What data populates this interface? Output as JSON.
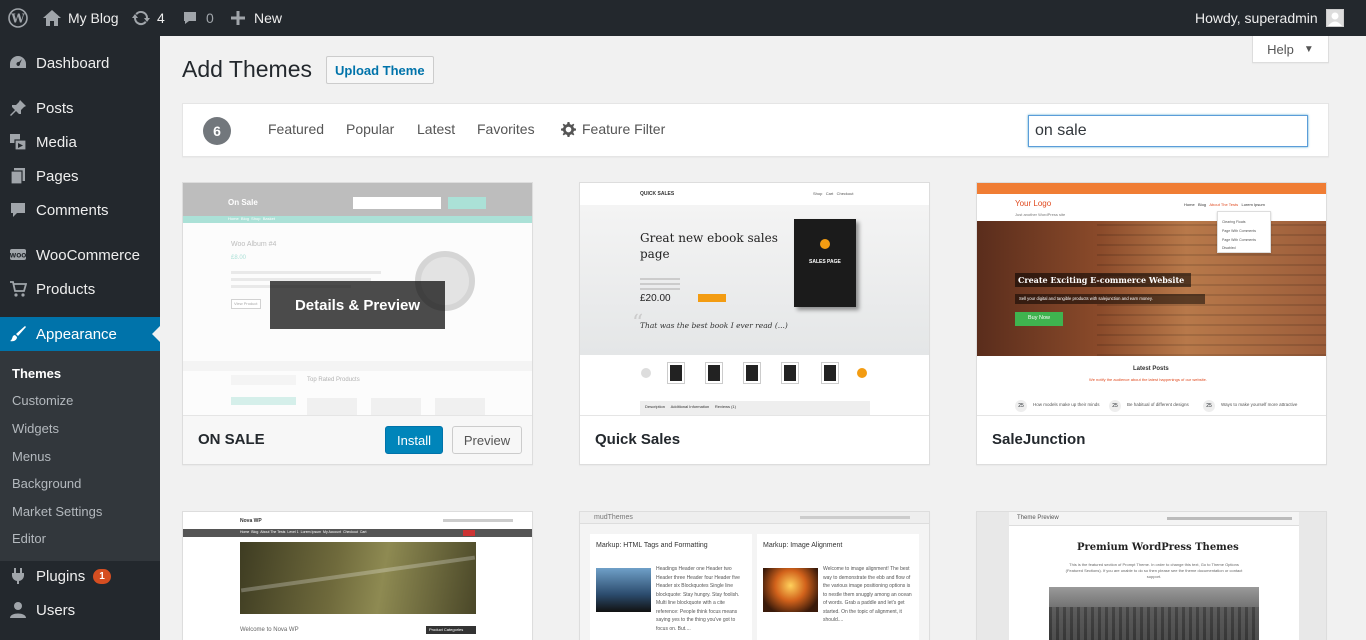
{
  "adminbar": {
    "site_name": "My Blog",
    "updates_count": "4",
    "comments_count": "0",
    "new_label": "New",
    "howdy": "Howdy, superadmin"
  },
  "sidebar": {
    "items": [
      {
        "label": "Dashboard",
        "icon": "dashboard-icon"
      },
      {
        "label": "Posts",
        "icon": "pin-icon"
      },
      {
        "label": "Media",
        "icon": "media-icon"
      },
      {
        "label": "Pages",
        "icon": "pages-icon"
      },
      {
        "label": "Comments",
        "icon": "comment-icon"
      },
      {
        "label": "WooCommerce",
        "icon": "woo-icon"
      },
      {
        "label": "Products",
        "icon": "cart-icon"
      },
      {
        "label": "Appearance",
        "icon": "brush-icon"
      },
      {
        "label": "Plugins",
        "icon": "plug-icon",
        "badge": "1"
      },
      {
        "label": "Users",
        "icon": "user-icon"
      }
    ],
    "submenu": [
      "Themes",
      "Customize",
      "Widgets",
      "Menus",
      "Background",
      "Market Settings",
      "Editor"
    ]
  },
  "page": {
    "title": "Add Themes",
    "upload_label": "Upload Theme",
    "help_label": "Help"
  },
  "filter": {
    "count": "6",
    "tabs": [
      "Featured",
      "Popular",
      "Latest",
      "Favorites"
    ],
    "feature_filter": "Feature Filter",
    "search_value": "on sale"
  },
  "themes": [
    {
      "name": "ON SALE",
      "install": "Install",
      "preview": "Preview",
      "overlay": "Details & Preview",
      "shot": {
        "logo": "On Sale",
        "album": "Woo Album #4",
        "view": "View Product",
        "top_rated": "Top Rated Products",
        "nav": [
          "Home",
          "Blog",
          "Shop",
          "Basket"
        ],
        "price": "£8.00"
      }
    },
    {
      "name": "Quick Sales",
      "shot": {
        "logo": "QUICK SALES",
        "headline1": "Great new ebook sales",
        "headline2": "page",
        "price": "£20.00",
        "quote": "That was the best book I ever read (...)",
        "book": "SALES PAGE",
        "tabs": [
          "Description",
          "Additional Information",
          "Reviews (1)"
        ],
        "nav": [
          "Shop",
          "Cart",
          "Checkout"
        ]
      }
    },
    {
      "name": "SaleJunction",
      "shot": {
        "logo": "Your Logo",
        "tagline": "Just another WordPress site",
        "hero": "Create Exciting E-commerce Website",
        "hero_sub": "Sell your digital and tangible products with salejunction and earn money.",
        "buy": "Buy Now",
        "latest": "Latest Posts",
        "latest_sub": "We notify the audience about the latest happenings of our website.",
        "nav": [
          "Home",
          "Blog",
          "About The Tests",
          "Lorem Ipsum"
        ],
        "dropdown": [
          "Clearing Floats",
          "Page With Comments",
          "Page With Comments",
          "Disabled"
        ],
        "posts": [
          {
            "num": "25",
            "title": "How models make up their minds"
          },
          {
            "num": "25",
            "title": "Be habitual of different designs"
          },
          {
            "num": "25",
            "title": "Ways to make yourself more attractive"
          }
        ]
      }
    },
    {
      "name": "Nova WP",
      "shot": {
        "logo": "Nova WP",
        "welcome": "Welcome to Nova WP",
        "categories": "Product Categories",
        "nav": [
          "Home",
          "Blog",
          "About The Tests",
          "Level 1",
          "Lorem Ipsum",
          "My Account",
          "Checkout",
          "Cart"
        ]
      }
    },
    {
      "name": "mudThemes",
      "shot": {
        "logo": "mudThemes",
        "post1": "Markup: HTML Tags and Formatting",
        "post2": "Markup: Image Alignment",
        "text1": "Headings Header one Header two Header three Header four Header five Header six Blockquotes Single line blockquote: Stay hungry. Stay foolish. Multi line blockquote with a cite reference: People think focus means saying yes to the thing you've got to focus on. But....",
        "text2": "Welcome to image alignment! The best way to demonstrate the ebb and flow of the various image positioning options is to nestle them snuggly among an ocean of words. Grab a paddle and let's get started. On the topic of alignment, it should...."
      }
    },
    {
      "name": "Premium WordPress Themes",
      "shot": {
        "logo": "Theme Preview",
        "headline": "Premium WordPress Themes",
        "sub": "This is the featured section of Prompt Theme. In order to change this text, Go to Theme Options (Featured Sections). If you are unable to do so then please see the theme documentation or contact support."
      }
    }
  ],
  "colors": {
    "adminbar": "#23282d",
    "accent": "#0073aa",
    "install": "#0085ba",
    "badge": "#d54e21",
    "salejunction_orange": "#f07d34"
  }
}
